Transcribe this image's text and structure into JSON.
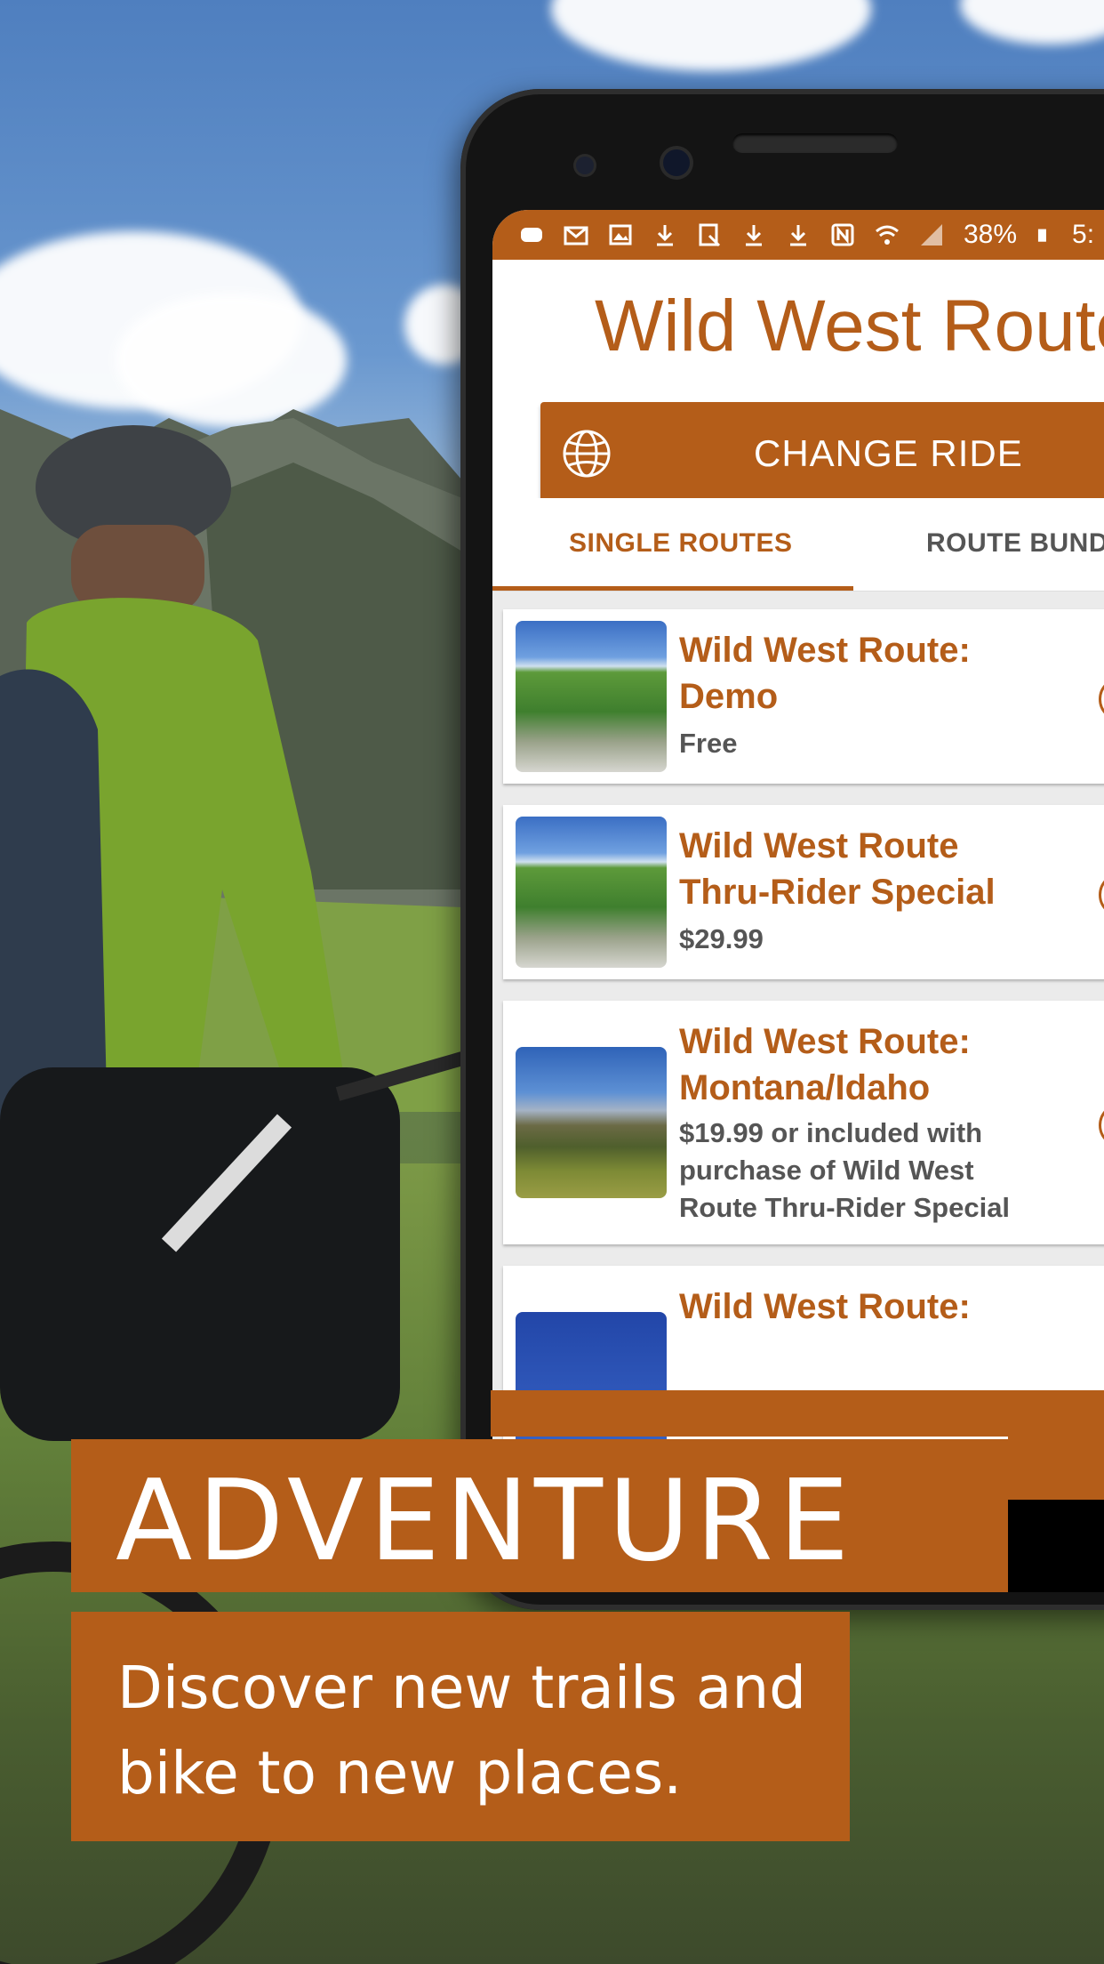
{
  "status_bar": {
    "battery": "38%",
    "time": "5:",
    "icons": [
      "message-icon",
      "mail-icon",
      "image-icon",
      "download-icon",
      "screenshot-icon",
      "download-icon",
      "download-icon",
      "nfc-icon",
      "wifi-icon",
      "signal-icon",
      "battery-icon"
    ]
  },
  "app": {
    "title": "Wild West Route",
    "change_ride_label": "CHANGE RIDE",
    "tabs": [
      {
        "label": "SINGLE ROUTES",
        "selected": true
      },
      {
        "label": "ROUTE BUNDL",
        "selected": false
      }
    ],
    "routes": [
      {
        "title_line1": "Wild West Route:",
        "title_line2": "Demo",
        "price": "Free"
      },
      {
        "title_line1": "Wild West Route",
        "title_line2": "Thru-Rider Special",
        "price": "$29.99"
      },
      {
        "title_line1": "Wild West Route:",
        "title_line2": "Montana/Idaho",
        "price_line1": "$19.99 or included with",
        "price_line2": "purchase of Wild West",
        "price_line3": "Route Thru-Rider Special"
      },
      {
        "title_line1": "Wild West Route:"
      }
    ]
  },
  "promo": {
    "headline": "ADVENTURE",
    "tagline_line1": "Discover new trails and",
    "tagline_line2": "bike to new places."
  },
  "colors": {
    "accent": "#b45d19",
    "screen_bg": "#ebebeb"
  }
}
